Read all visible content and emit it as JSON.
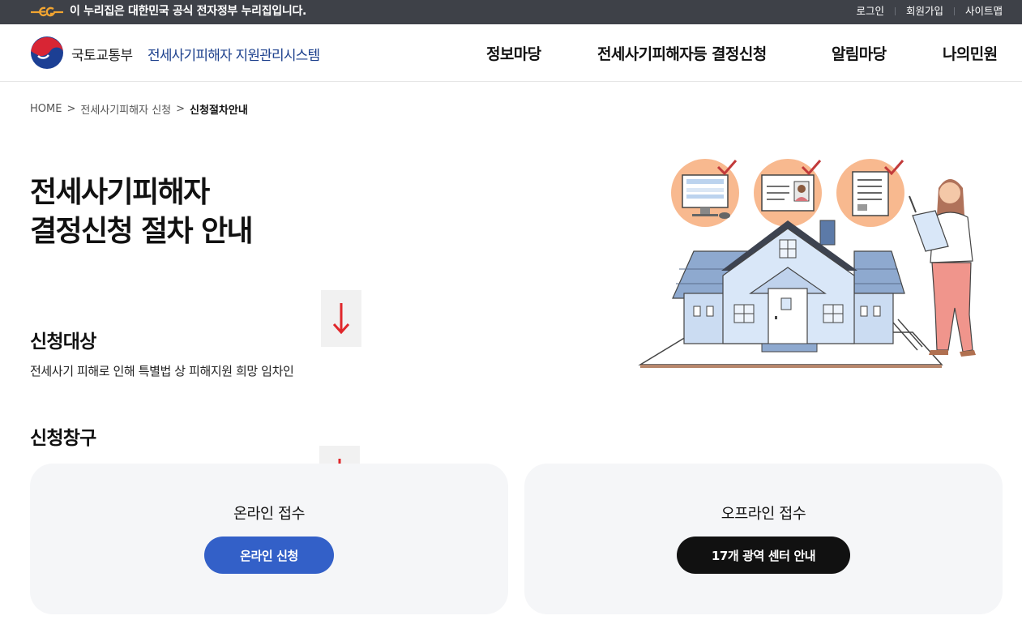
{
  "gov_banner": {
    "text": "이 누리집은 대한민국 공식 전자정부 누리집입니다.",
    "util_links": [
      "로그인",
      "회원가입",
      "사이트맵"
    ]
  },
  "header": {
    "ministry": "국토교통부",
    "system_name": "전세사기피해자 지원관리시스템",
    "nav": [
      "정보마당",
      "전세사기피해자등 결정신청",
      "알림마당",
      "나의민원"
    ]
  },
  "breadcrumb": [
    "HOME",
    "전세사기피해자 신청",
    "신청절차안내"
  ],
  "title": {
    "line1": "전세사기피해자",
    "line2": "결정신청 절차 안내"
  },
  "target": {
    "title": "신청대상",
    "desc": "전세사기 피해로 인해 특별법 상 피해지원 희망 임차인"
  },
  "window": {
    "title": "신청창구",
    "online": {
      "title": "온라인 접수",
      "button": "온라인 신청"
    },
    "offline": {
      "title": "오프라인 접수",
      "button": "17개 광역 센터 안내"
    }
  },
  "colors": {
    "gov_bar": "#3e4148",
    "brand_blue": "#1b3f8c",
    "online_button": "#3360c8",
    "offline_button": "#111111",
    "arrow_red": "#e0272b",
    "card_bg": "#f5f6f8"
  },
  "icons": [
    "government-eg-logo",
    "taegeuk-emblem-icon",
    "down-arrow-icon",
    "house-illustration"
  ]
}
